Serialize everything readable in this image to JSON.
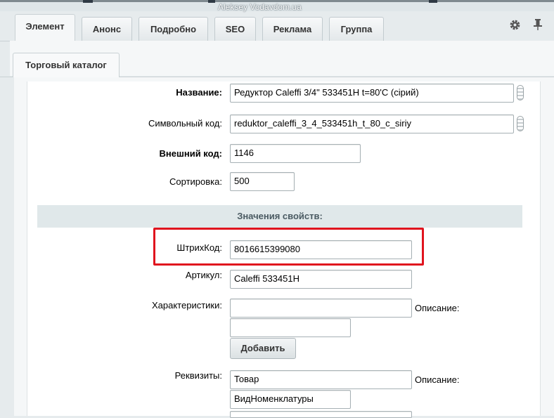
{
  "watermark": "Aleksey Vodavdom.ua",
  "tabs": [
    {
      "label": "Элемент",
      "active": true
    },
    {
      "label": "Анонс"
    },
    {
      "label": "Подробно"
    },
    {
      "label": "SEO"
    },
    {
      "label": "Реклама"
    },
    {
      "label": "Группа"
    }
  ],
  "subtabs": [
    {
      "label": "Торговый каталог"
    }
  ],
  "fields": {
    "name": {
      "label": "Название:",
      "value": "Редуктор Caleffi 3/4\" 533451H t=80'C (сірий)"
    },
    "code": {
      "label": "Символьный код:",
      "value": "reduktor_caleffi_3_4_533451h_t_80_c_siriy"
    },
    "xml_id": {
      "label": "Внешний код:",
      "value": "1146"
    },
    "sort": {
      "label": "Сортировка:",
      "value": "500"
    }
  },
  "properties": {
    "title": "Значения свойств:",
    "barcode": {
      "label": "ШтрихКод:",
      "value": "8016615399080"
    },
    "article": {
      "label": "Артикул:",
      "value": "Caleffi 533451H"
    },
    "characteristics": {
      "label": "Характеристики:",
      "desc_label": "Описание:",
      "value": "",
      "desc_value": ""
    },
    "add_button": "Добавить",
    "requisites": {
      "label": "Реквизиты:",
      "desc_label": "Описание:",
      "value": "Товар",
      "desc_value": "ВидНоменклатуры"
    }
  }
}
